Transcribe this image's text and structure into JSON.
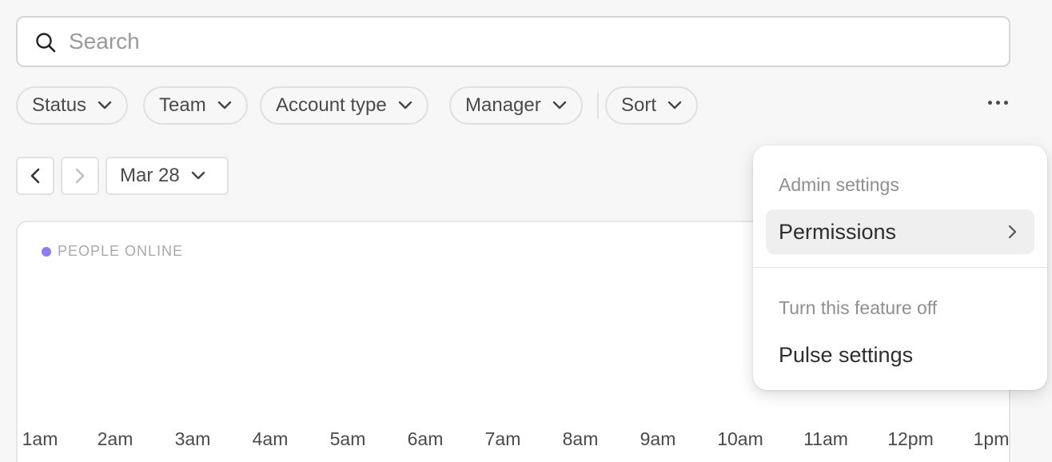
{
  "search": {
    "placeholder": "Search"
  },
  "filters": [
    {
      "label": "Status"
    },
    {
      "label": "Team"
    },
    {
      "label": "Account type"
    },
    {
      "label": "Manager"
    },
    {
      "label": "Sort"
    }
  ],
  "date_nav": {
    "current_date": "Mar 28"
  },
  "chart": {
    "legend_label": "PEOPLE ONLINE",
    "legend_color": "#8b7cf6",
    "x_ticks": [
      "1am",
      "2am",
      "3am",
      "4am",
      "5am",
      "6am",
      "7am",
      "8am",
      "9am",
      "10am",
      "11am",
      "12pm",
      "1pm"
    ]
  },
  "chart_data": {
    "type": "area",
    "series": [
      {
        "name": "PEOPLE ONLINE",
        "values": []
      }
    ],
    "categories": [
      "1am",
      "2am",
      "3am",
      "4am",
      "5am",
      "6am",
      "7am",
      "8am",
      "9am",
      "10am",
      "11am",
      "12pm",
      "1pm"
    ],
    "xlabel": "",
    "ylabel": "",
    "grid": false
  },
  "menu": {
    "section1_heading": "Admin settings",
    "permissions_label": "Permissions",
    "section2_heading": "Turn this feature off",
    "pulse_settings_label": "Pulse settings"
  }
}
